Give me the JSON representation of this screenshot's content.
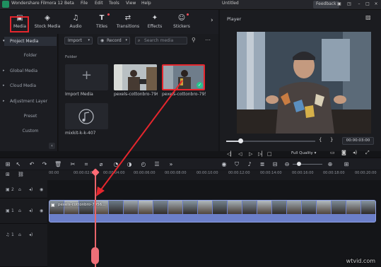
{
  "window": {
    "app_title": "Wondershare Filmora 12 Beta",
    "menus": [
      "File",
      "Edit",
      "Tools",
      "View",
      "Help"
    ],
    "doc_title": "Untitled",
    "feedback_label": "Feedback"
  },
  "tabs": [
    {
      "label": "Media",
      "icon": "media-icon",
      "selected": true
    },
    {
      "label": "Stock Media",
      "icon": "stock-media-icon"
    },
    {
      "label": "Audio",
      "icon": "audio-icon"
    },
    {
      "label": "Titles",
      "icon": "titles-icon"
    },
    {
      "label": "Transitions",
      "icon": "transitions-icon"
    },
    {
      "label": "Effects",
      "icon": "effects-icon"
    },
    {
      "label": "Stickers",
      "icon": "stickers-icon"
    }
  ],
  "sidebar": {
    "items": [
      {
        "label": "Project Media"
      },
      {
        "label": "Folder"
      },
      {
        "label": "Global Media"
      },
      {
        "label": "Cloud Media"
      },
      {
        "label": "Adjustment Layer"
      },
      {
        "label": "Preset"
      },
      {
        "label": "Custom"
      }
    ]
  },
  "browser": {
    "import_label": "Import",
    "record_label": "Record",
    "search_placeholder": "Search media",
    "folder_label": "Folder",
    "items": [
      {
        "caption": "Import Media"
      },
      {
        "caption": "pexels-cottonbro-796..."
      },
      {
        "caption": "pexels-cottonbro-795..."
      },
      {
        "caption": "mixkit-k-k-407"
      }
    ]
  },
  "player": {
    "title": "Player",
    "timecode": "00:00:03:00",
    "quality": "Full Quality"
  },
  "timeline": {
    "ruler": [
      "00:00",
      "00:00:02:00",
      "00:00:04:00",
      "00:00:06:00",
      "00:00:08:00",
      "00:00:10:00",
      "00:00:12:00",
      "00:00:14:00",
      "00:00:16:00",
      "00:00:18:00",
      "00:00:20:00"
    ],
    "track_labels": [
      "2",
      "1",
      "1"
    ],
    "clip_name": "pexels-cottonbro-7956..."
  },
  "watermark": "wtvid.com",
  "colors": {
    "accent": "#5b6fc7",
    "highlight": "#e5262d",
    "playhead": "#ee6f78"
  }
}
